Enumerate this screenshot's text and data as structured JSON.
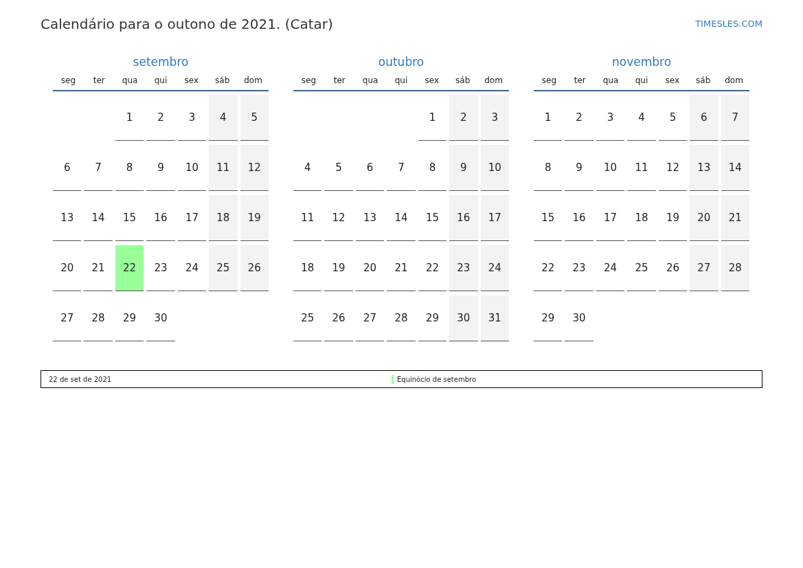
{
  "title": "Calendário para o outono de 2021. (Catar)",
  "site": "TIMESLES.COM",
  "months": [
    {
      "name": "setembro",
      "weekdays": [
        "seg",
        "ter",
        "qua",
        "qui",
        "sex",
        "sáb",
        "dom"
      ],
      "weeks": [
        {
          "kind": "lead",
          "days": [
            {
              "day": "1",
              "weekend": false,
              "holiday": false
            },
            {
              "day": "2",
              "weekend": false,
              "holiday": false
            },
            {
              "day": "3",
              "weekend": false,
              "holiday": false
            },
            {
              "day": "4",
              "weekend": true,
              "holiday": false
            },
            {
              "day": "5",
              "weekend": true,
              "holiday": false
            }
          ]
        },
        {
          "kind": "full",
          "days": [
            {
              "day": "6",
              "weekend": false,
              "holiday": false
            },
            {
              "day": "7",
              "weekend": false,
              "holiday": false
            },
            {
              "day": "8",
              "weekend": false,
              "holiday": false
            },
            {
              "day": "9",
              "weekend": false,
              "holiday": false
            },
            {
              "day": "10",
              "weekend": false,
              "holiday": false
            },
            {
              "day": "11",
              "weekend": true,
              "holiday": false
            },
            {
              "day": "12",
              "weekend": true,
              "holiday": false
            }
          ]
        },
        {
          "kind": "full",
          "days": [
            {
              "day": "13",
              "weekend": false,
              "holiday": false
            },
            {
              "day": "14",
              "weekend": false,
              "holiday": false
            },
            {
              "day": "15",
              "weekend": false,
              "holiday": false
            },
            {
              "day": "16",
              "weekend": false,
              "holiday": false
            },
            {
              "day": "17",
              "weekend": false,
              "holiday": false
            },
            {
              "day": "18",
              "weekend": true,
              "holiday": false
            },
            {
              "day": "19",
              "weekend": true,
              "holiday": false
            }
          ]
        },
        {
          "kind": "full",
          "days": [
            {
              "day": "20",
              "weekend": false,
              "holiday": false
            },
            {
              "day": "21",
              "weekend": false,
              "holiday": false
            },
            {
              "day": "22",
              "weekend": false,
              "holiday": true
            },
            {
              "day": "23",
              "weekend": false,
              "holiday": false
            },
            {
              "day": "24",
              "weekend": false,
              "holiday": false
            },
            {
              "day": "25",
              "weekend": true,
              "holiday": false
            },
            {
              "day": "26",
              "weekend": true,
              "holiday": false
            }
          ]
        },
        {
          "kind": "tail",
          "days": [
            {
              "day": "27",
              "weekend": false,
              "holiday": false
            },
            {
              "day": "28",
              "weekend": false,
              "holiday": false
            },
            {
              "day": "29",
              "weekend": false,
              "holiday": false
            },
            {
              "day": "30",
              "weekend": false,
              "holiday": false
            }
          ]
        }
      ]
    },
    {
      "name": "outubro",
      "weekdays": [
        "seg",
        "ter",
        "qua",
        "qui",
        "sex",
        "sáb",
        "dom"
      ],
      "weeks": [
        {
          "kind": "lead",
          "days": [
            {
              "day": "1",
              "weekend": false,
              "holiday": false
            },
            {
              "day": "2",
              "weekend": true,
              "holiday": false
            },
            {
              "day": "3",
              "weekend": true,
              "holiday": false
            }
          ]
        },
        {
          "kind": "full",
          "days": [
            {
              "day": "4",
              "weekend": false,
              "holiday": false
            },
            {
              "day": "5",
              "weekend": false,
              "holiday": false
            },
            {
              "day": "6",
              "weekend": false,
              "holiday": false
            },
            {
              "day": "7",
              "weekend": false,
              "holiday": false
            },
            {
              "day": "8",
              "weekend": false,
              "holiday": false
            },
            {
              "day": "9",
              "weekend": true,
              "holiday": false
            },
            {
              "day": "10",
              "weekend": true,
              "holiday": false
            }
          ]
        },
        {
          "kind": "full",
          "days": [
            {
              "day": "11",
              "weekend": false,
              "holiday": false
            },
            {
              "day": "12",
              "weekend": false,
              "holiday": false
            },
            {
              "day": "13",
              "weekend": false,
              "holiday": false
            },
            {
              "day": "14",
              "weekend": false,
              "holiday": false
            },
            {
              "day": "15",
              "weekend": false,
              "holiday": false
            },
            {
              "day": "16",
              "weekend": true,
              "holiday": false
            },
            {
              "day": "17",
              "weekend": true,
              "holiday": false
            }
          ]
        },
        {
          "kind": "full",
          "days": [
            {
              "day": "18",
              "weekend": false,
              "holiday": false
            },
            {
              "day": "19",
              "weekend": false,
              "holiday": false
            },
            {
              "day": "20",
              "weekend": false,
              "holiday": false
            },
            {
              "day": "21",
              "weekend": false,
              "holiday": false
            },
            {
              "day": "22",
              "weekend": false,
              "holiday": false
            },
            {
              "day": "23",
              "weekend": true,
              "holiday": false
            },
            {
              "day": "24",
              "weekend": true,
              "holiday": false
            }
          ]
        },
        {
          "kind": "full",
          "days": [
            {
              "day": "25",
              "weekend": false,
              "holiday": false
            },
            {
              "day": "26",
              "weekend": false,
              "holiday": false
            },
            {
              "day": "27",
              "weekend": false,
              "holiday": false
            },
            {
              "day": "28",
              "weekend": false,
              "holiday": false
            },
            {
              "day": "29",
              "weekend": false,
              "holiday": false
            },
            {
              "day": "30",
              "weekend": true,
              "holiday": false
            },
            {
              "day": "31",
              "weekend": true,
              "holiday": false
            }
          ]
        }
      ]
    },
    {
      "name": "novembro",
      "weekdays": [
        "seg",
        "ter",
        "qua",
        "qui",
        "sex",
        "sáb",
        "dom"
      ],
      "weeks": [
        {
          "kind": "full",
          "days": [
            {
              "day": "1",
              "weekend": false,
              "holiday": false
            },
            {
              "day": "2",
              "weekend": false,
              "holiday": false
            },
            {
              "day": "3",
              "weekend": false,
              "holiday": false
            },
            {
              "day": "4",
              "weekend": false,
              "holiday": false
            },
            {
              "day": "5",
              "weekend": false,
              "holiday": false
            },
            {
              "day": "6",
              "weekend": true,
              "holiday": false
            },
            {
              "day": "7",
              "weekend": true,
              "holiday": false
            }
          ]
        },
        {
          "kind": "full",
          "days": [
            {
              "day": "8",
              "weekend": false,
              "holiday": false
            },
            {
              "day": "9",
              "weekend": false,
              "holiday": false
            },
            {
              "day": "10",
              "weekend": false,
              "holiday": false
            },
            {
              "day": "11",
              "weekend": false,
              "holiday": false
            },
            {
              "day": "12",
              "weekend": false,
              "holiday": false
            },
            {
              "day": "13",
              "weekend": true,
              "holiday": false
            },
            {
              "day": "14",
              "weekend": true,
              "holiday": false
            }
          ]
        },
        {
          "kind": "full",
          "days": [
            {
              "day": "15",
              "weekend": false,
              "holiday": false
            },
            {
              "day": "16",
              "weekend": false,
              "holiday": false
            },
            {
              "day": "17",
              "weekend": false,
              "holiday": false
            },
            {
              "day": "18",
              "weekend": false,
              "holiday": false
            },
            {
              "day": "19",
              "weekend": false,
              "holiday": false
            },
            {
              "day": "20",
              "weekend": true,
              "holiday": false
            },
            {
              "day": "21",
              "weekend": true,
              "holiday": false
            }
          ]
        },
        {
          "kind": "full",
          "days": [
            {
              "day": "22",
              "weekend": false,
              "holiday": false
            },
            {
              "day": "23",
              "weekend": false,
              "holiday": false
            },
            {
              "day": "24",
              "weekend": false,
              "holiday": false
            },
            {
              "day": "25",
              "weekend": false,
              "holiday": false
            },
            {
              "day": "26",
              "weekend": false,
              "holiday": false
            },
            {
              "day": "27",
              "weekend": true,
              "holiday": false
            },
            {
              "day": "28",
              "weekend": true,
              "holiday": false
            }
          ]
        },
        {
          "kind": "tail",
          "days": [
            {
              "day": "29",
              "weekend": false,
              "holiday": false
            },
            {
              "day": "30",
              "weekend": false,
              "holiday": false
            }
          ]
        }
      ]
    }
  ],
  "legend": [
    {
      "date": "22 de set de 2021",
      "name": "Equinócio de setembro",
      "color": "#99ff99"
    }
  ]
}
